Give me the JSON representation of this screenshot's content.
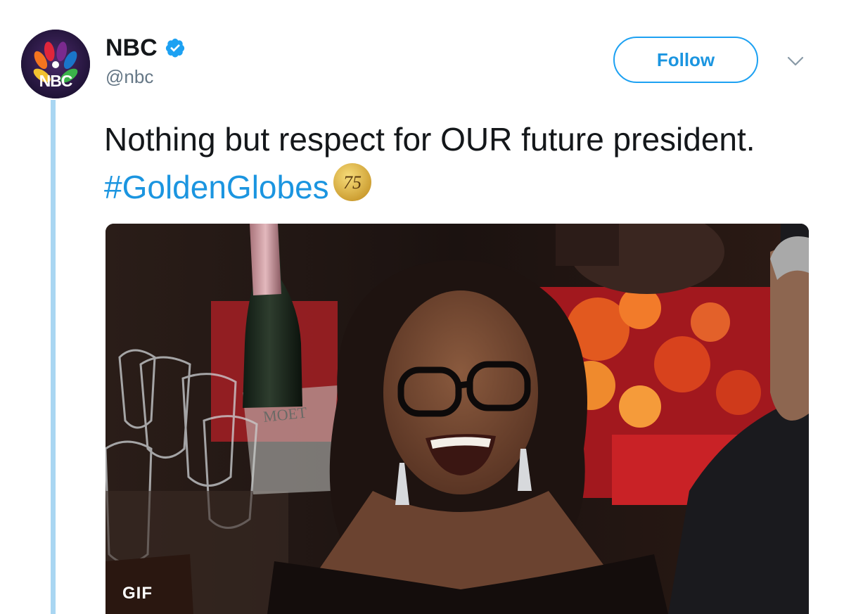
{
  "account": {
    "display_name": "NBC",
    "handle": "@nbc",
    "avatar_text": "NBC",
    "verified": true
  },
  "header": {
    "follow_label": "Follow",
    "menu_icon": "chevron-down-icon"
  },
  "tweet": {
    "text": "Nothing but respect for OUR future president.",
    "hashtag": "#GoldenGlobes",
    "hashflag_text": "75"
  },
  "media": {
    "badge": "GIF",
    "bottle_label": "MOET"
  },
  "colors": {
    "accent": "#1da1f2",
    "link": "#1b95e0",
    "text": "#14171a",
    "muted": "#657786",
    "thread_line": "#a9d6f2"
  }
}
